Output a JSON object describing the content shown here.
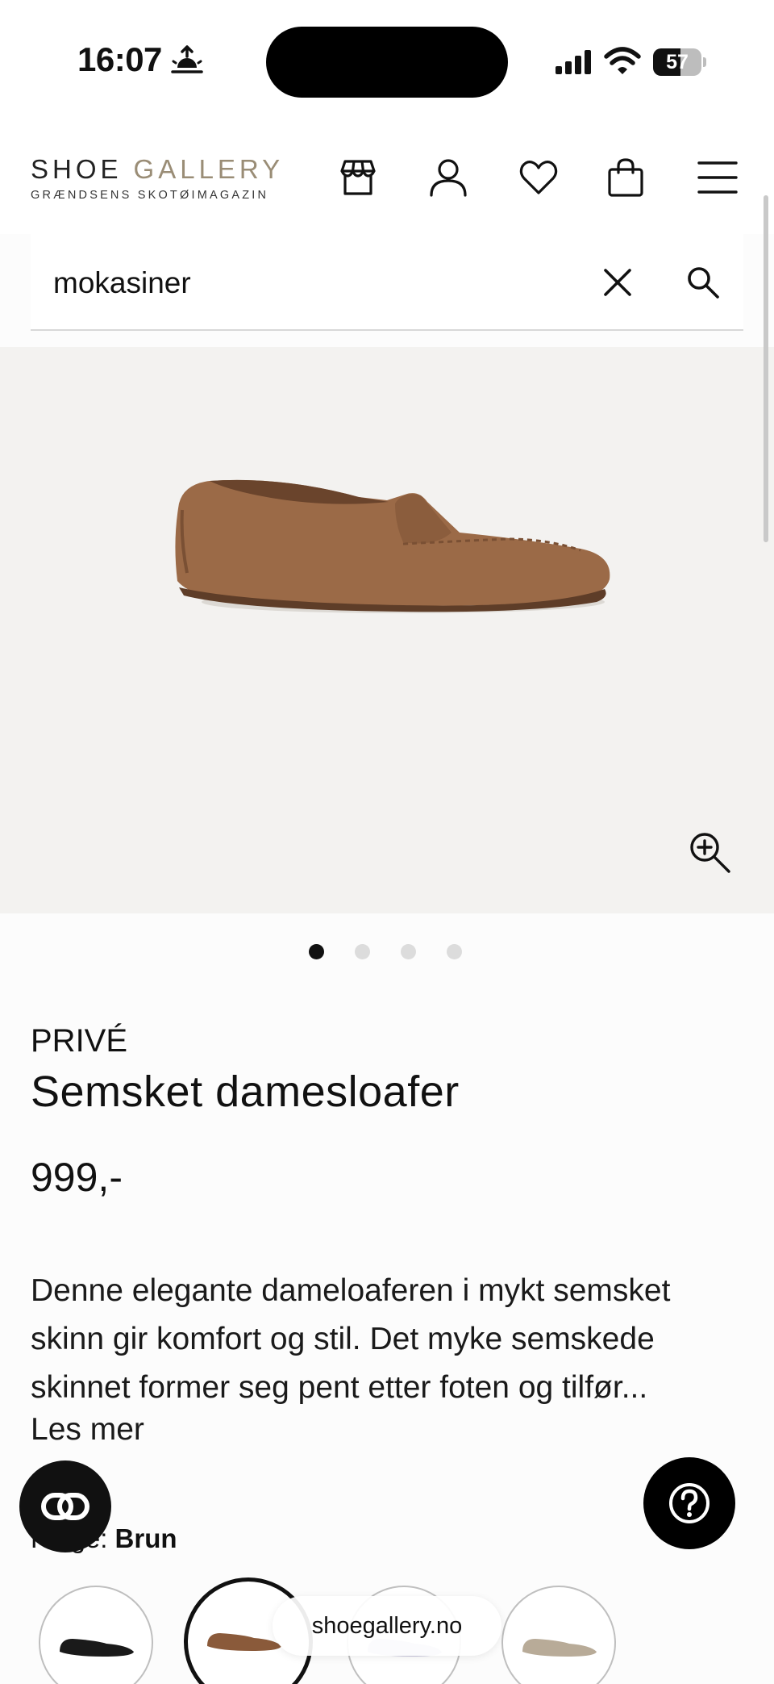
{
  "status_bar": {
    "time": "16:07",
    "battery": "57",
    "battery_level": 0.57
  },
  "header": {
    "logo_left": "SHOE",
    "logo_right": "GALLERY",
    "logo_tagline": "GRÆNDSENS SKOTØIMAGAZIN",
    "icons": [
      "store-icon",
      "user-icon",
      "heart-icon",
      "bag-icon",
      "menu-icon"
    ]
  },
  "search": {
    "value": "mokasiner"
  },
  "gallery": {
    "image_count": 4,
    "active_index": 0
  },
  "product": {
    "brand": "PRIVÉ",
    "name": "Semsket damesloafer",
    "price": "999,-",
    "description": "Denne elegante dameloaferen i mykt semsket skinn gir komfort og stil. Det myke semskede skinnet former seg pent etter foten og tilfør...",
    "read_more": "Les mer",
    "color_label": "Farge:",
    "color_value": "Brun"
  },
  "swatches": [
    {
      "name": "swatch-black",
      "color": "#1a1a1a"
    },
    {
      "name": "swatch-brown",
      "color": "#8a5a3a",
      "selected": true
    },
    {
      "name": "swatch-lavender",
      "color": "#c8c6dc"
    },
    {
      "name": "swatch-beige",
      "color": "#b8ab98"
    }
  ],
  "browser": {
    "url": "shoegallery.no"
  },
  "colors": {
    "accent": "#9a8d76",
    "shoe": "#9b6a47"
  }
}
